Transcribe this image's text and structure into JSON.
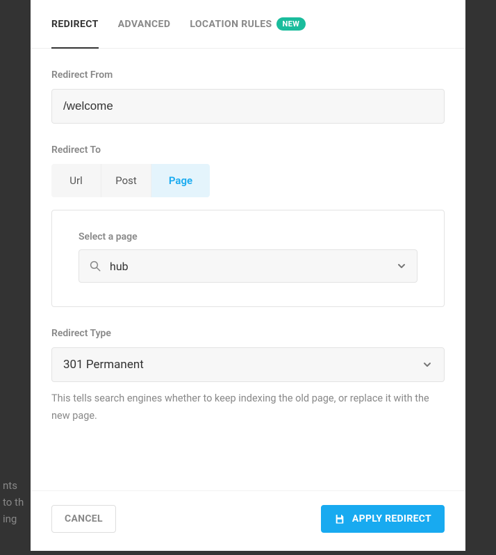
{
  "tabs": {
    "redirect": "REDIRECT",
    "advanced": "ADVANCED",
    "location_rules": "LOCATION RULES",
    "new_badge": "NEW"
  },
  "form": {
    "from_label": "Redirect From",
    "from_value": "/welcome",
    "to_label": "Redirect To",
    "to_options": {
      "url": "Url",
      "post": "Post",
      "page": "Page"
    },
    "select_page_label": "Select a page",
    "select_page_value": "hub",
    "type_label": "Redirect Type",
    "type_value": "301 Permanent",
    "type_help": "This tells search engines whether to keep indexing the old page, or replace it with the new page."
  },
  "footer": {
    "cancel": "CANCEL",
    "apply": "APPLY REDIRECT"
  },
  "backdrop": {
    "line1": "nts",
    "line2": "to th",
    "line3": "ing"
  }
}
